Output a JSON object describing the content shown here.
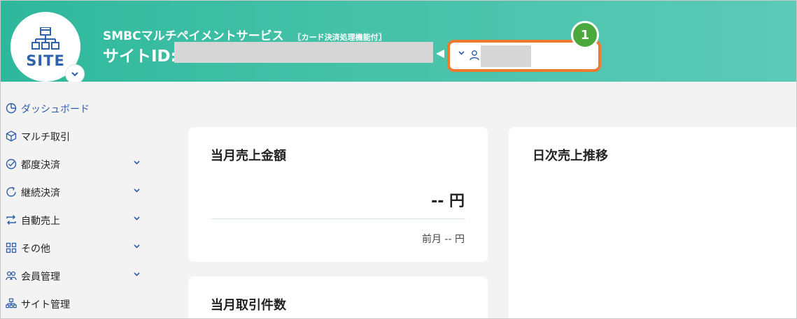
{
  "header": {
    "logo_text": "SITE",
    "service_name": "SMBCマルチペイメントサービス",
    "service_sub": "〖カード決済処理機能付〗",
    "site_id_label": "サイトID:",
    "badge_number": "1"
  },
  "sidebar": {
    "items": [
      {
        "label": "ダッシュボード",
        "icon": "clock-icon",
        "active": true,
        "expandable": false
      },
      {
        "label": "マルチ取引",
        "icon": "cube-icon",
        "active": false,
        "expandable": false
      },
      {
        "label": "都度決済",
        "icon": "check-circle-icon",
        "active": false,
        "expandable": true
      },
      {
        "label": "継続決済",
        "icon": "refresh-icon",
        "active": false,
        "expandable": true
      },
      {
        "label": "自動売上",
        "icon": "exchange-icon",
        "active": false,
        "expandable": true
      },
      {
        "label": "その他",
        "icon": "grid-icon",
        "active": false,
        "expandable": true
      },
      {
        "label": "会員管理",
        "icon": "users-icon",
        "active": false,
        "expandable": true
      },
      {
        "label": "サイト管理",
        "icon": "sitemap-icon",
        "active": false,
        "expandable": false
      }
    ]
  },
  "main": {
    "monthly_sales": {
      "title": "当月売上金額",
      "amount": "-- 円",
      "prev_month": "前月 -- 円"
    },
    "daily_trend": {
      "title": "日次売上推移"
    },
    "monthly_count": {
      "title": "当月取引件数"
    }
  },
  "colors": {
    "header_start": "#2fb89c",
    "header_end": "#5ccab8",
    "accent_blue": "#2d5fa8",
    "highlight_orange": "#ec7a31",
    "badge_green": "#4aa83c"
  }
}
